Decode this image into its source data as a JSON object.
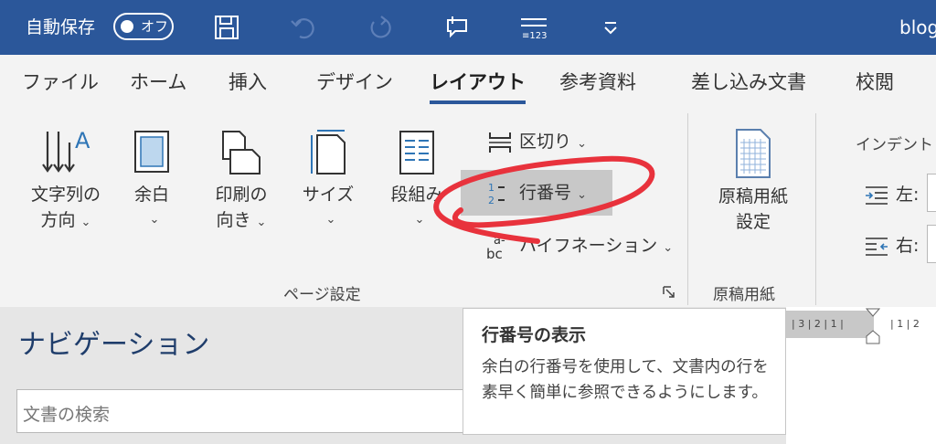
{
  "titlebar": {
    "autosave_label": "自動保存",
    "autosave_state": "オフ",
    "doc_title": "blog"
  },
  "tabs": [
    "ファイル",
    "ホーム",
    "挿入",
    "デザイン",
    "レイアウト",
    "参考資料",
    "差し込み文書",
    "校閲"
  ],
  "active_tab": "レイアウト",
  "ribbon": {
    "text_direction": [
      "文字列の",
      "方向"
    ],
    "margins": "余白",
    "orientation": [
      "印刷の",
      "向き"
    ],
    "size": "サイズ",
    "columns": "段組み",
    "breaks": "区切り",
    "line_numbers": "行番号",
    "hyphenation": "ハイフネーション",
    "page_setup_group": "ページ設定",
    "manuscript_btn": [
      "原稿用紙",
      "設定"
    ],
    "manuscript_group": "原稿用紙",
    "indent_group": "インデント",
    "indent_left": "左:",
    "indent_right": "右:"
  },
  "nav": {
    "title": "ナビゲーション",
    "search_placeholder": "文書の検索"
  },
  "ruler": {
    "left_marks": "| 3 | 2 | 1 |",
    "right_marks": "| 1 | 2"
  },
  "tooltip": {
    "title": "行番号の表示",
    "body": "余白の行番号を使用して、文書内の行を素早く簡単に参照できるようにします。"
  },
  "colors": {
    "titlebar": "#2b579a",
    "ribbon": "#f3f3f3",
    "annotation": "#e8323c"
  }
}
